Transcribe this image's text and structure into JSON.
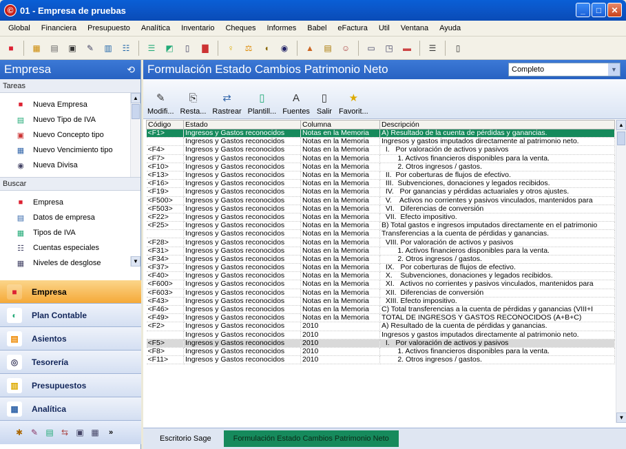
{
  "window": {
    "logo": "©",
    "title": "01 - Empresa de pruebas",
    "min": "_",
    "max": "□",
    "close": "✕"
  },
  "menu": [
    "Global",
    "Financiera",
    "Presupuesto",
    "Analítica",
    "Inventario",
    "Cheques",
    "Informes",
    "Babel",
    "eFactura",
    "Util",
    "Ventana",
    "Ayuda"
  ],
  "left": {
    "header": "Empresa",
    "pin": "⟲",
    "tareas_title": "Tareas",
    "tareas": [
      "Nueva Empresa",
      "Nuevo Tipo de IVA",
      "Nuevo Concepto tipo",
      "Nuevo Vencimiento tipo",
      "Nueva Divisa"
    ],
    "buscar_title": "Buscar",
    "buscar": [
      "Empresa",
      "Datos de empresa",
      "Tipos de IVA",
      "Cuentas especiales",
      "Niveles de desglose"
    ],
    "nav": [
      "Empresa",
      "Plan Contable",
      "Asientos",
      "Tesorería",
      "Presupuestos",
      "Analítica"
    ],
    "more": "»"
  },
  "right": {
    "header": "Formulación Estado Cambios Patrimonio Neto",
    "select_value": "Completo",
    "tools": [
      "Modifi...",
      "Resta...",
      "Rastrear",
      "Plantill...",
      "Fuentes",
      "Salir",
      "Favorit..."
    ],
    "columns": [
      "Código",
      "Estado",
      "Columna",
      "Descripción"
    ],
    "rows": [
      {
        "c": "<F1>",
        "e": "Ingresos y Gastos reconocidos",
        "col": "Notas en la Memoria",
        "d": "A) Resultado de la cuenta de pérdidas y ganancias."
      },
      {
        "c": "",
        "e": "Ingresos y Gastos reconocidos",
        "col": "Notas en la Memoria",
        "d": "Ingresos y gastos imputados directamente al patrimonio neto."
      },
      {
        "c": "<F4>",
        "e": "Ingresos y Gastos reconocidos",
        "col": "Notas en la Memoria",
        "d": "  I.   Por valoración de activos y pasivos"
      },
      {
        "c": "<F7>",
        "e": "Ingresos y Gastos reconocidos",
        "col": "Notas en la Memoria",
        "d": "        1. Activos financieros disponibles para la venta."
      },
      {
        "c": "<F10>",
        "e": "Ingresos y Gastos reconocidos",
        "col": "Notas en la Memoria",
        "d": "        2. Otros ingresos / gastos."
      },
      {
        "c": "<F13>",
        "e": "Ingresos y Gastos reconocidos",
        "col": "Notas en la Memoria",
        "d": "  II.  Por coberturas de flujos de efectivo."
      },
      {
        "c": "<F16>",
        "e": "Ingresos y Gastos reconocidos",
        "col": "Notas en la Memoria",
        "d": "  III.  Subvenciones, donaciones y legados recibidos."
      },
      {
        "c": "<F19>",
        "e": "Ingresos y Gastos reconocidos",
        "col": "Notas en la Memoria",
        "d": "  IV.   Por ganancias y pérdidas actuariales y otros ajustes."
      },
      {
        "c": "<F500>",
        "e": "Ingresos y Gastos reconocidos",
        "col": "Notas en la Memoria",
        "d": "  V.    Activos no corrientes y pasivos vinculados, mantenidos para"
      },
      {
        "c": "<F503>",
        "e": "Ingresos y Gastos reconocidos",
        "col": "Notas en la Memoria",
        "d": "  VI.   Diferencias de conversión"
      },
      {
        "c": "<F22>",
        "e": "Ingresos y Gastos reconocidos",
        "col": "Notas en la Memoria",
        "d": "  VII.  Efecto impositivo."
      },
      {
        "c": "<F25>",
        "e": "Ingresos y Gastos reconocidos",
        "col": "Notas en la Memoria",
        "d": "B) Total gastos e ingresos imputados directamente en el patrimonio"
      },
      {
        "c": "",
        "e": "Ingresos y Gastos reconocidos",
        "col": "Notas en la Memoria",
        "d": "Transferencias a la cuenta de pérdidas y ganancias."
      },
      {
        "c": "<F28>",
        "e": "Ingresos y Gastos reconocidos",
        "col": "Notas en la Memoria",
        "d": "  VIII. Por valoración de activos y pasivos"
      },
      {
        "c": "<F31>",
        "e": "Ingresos y Gastos reconocidos",
        "col": "Notas en la Memoria",
        "d": "        1. Activos financieros disponibles para la venta."
      },
      {
        "c": "<F34>",
        "e": "Ingresos y Gastos reconocidos",
        "col": "Notas en la Memoria",
        "d": "        2. Otros ingresos / gastos."
      },
      {
        "c": "<F37>",
        "e": "Ingresos y Gastos reconocidos",
        "col": "Notas en la Memoria",
        "d": "  IX.   Por coberturas de flujos de efectivo."
      },
      {
        "c": "<F40>",
        "e": "Ingresos y Gastos reconocidos",
        "col": "Notas en la Memoria",
        "d": "  X.    Subvenciones, donaciones y legados recibidos."
      },
      {
        "c": "<F600>",
        "e": "Ingresos y Gastos reconocidos",
        "col": "Notas en la Memoria",
        "d": "  XI.   Activos no corrientes y pasivos vinculados, mantenidos para"
      },
      {
        "c": "<F603>",
        "e": "Ingresos y Gastos reconocidos",
        "col": "Notas en la Memoria",
        "d": "  XII.  Diferencias de conversión"
      },
      {
        "c": "<F43>",
        "e": "Ingresos y Gastos reconocidos",
        "col": "Notas en la Memoria",
        "d": "  XIII. Efecto impositivo."
      },
      {
        "c": "<F46>",
        "e": "Ingresos y Gastos reconocidos",
        "col": "Notas en la Memoria",
        "d": "C) Total transferencias a la cuenta de pérdidas y ganancias (VIII+I"
      },
      {
        "c": "<F49>",
        "e": "Ingresos y Gastos reconocidos",
        "col": "Notas en la Memoria",
        "d": "TOTAL DE INGRESOS Y GASTOS RECONOCIDOS (A+B+C)"
      },
      {
        "c": "<F2>",
        "e": "Ingresos y Gastos reconocidos",
        "col": "2010",
        "d": "A) Resultado de la cuenta de pérdidas y ganancias."
      },
      {
        "c": "",
        "e": "Ingresos y Gastos reconocidos",
        "col": "2010",
        "d": "Ingresos y gastos imputados directamente al patrimonio neto."
      },
      {
        "c": "<F5>",
        "e": "Ingresos y Gastos reconocidos",
        "col": "2010",
        "d": "  I.   Por valoración de activos y pasivos"
      },
      {
        "c": "<F8>",
        "e": "Ingresos y Gastos reconocidos",
        "col": "2010",
        "d": "        1. Activos financieros disponibles para la venta."
      },
      {
        "c": "<F11>",
        "e": "Ingresos y Gastos reconocidos",
        "col": "2010",
        "d": "        2. Otros ingresos / gastos."
      }
    ],
    "selected_row": 0,
    "highlighted_row": 25,
    "tabs": [
      "Escritorio Sage",
      "Formulación Estado Cambios Patrimonio Neto"
    ]
  },
  "colors": {
    "accent_green": "#168a5c",
    "title_blue": "#0a5fd6",
    "active_nav": "#f5a938"
  }
}
